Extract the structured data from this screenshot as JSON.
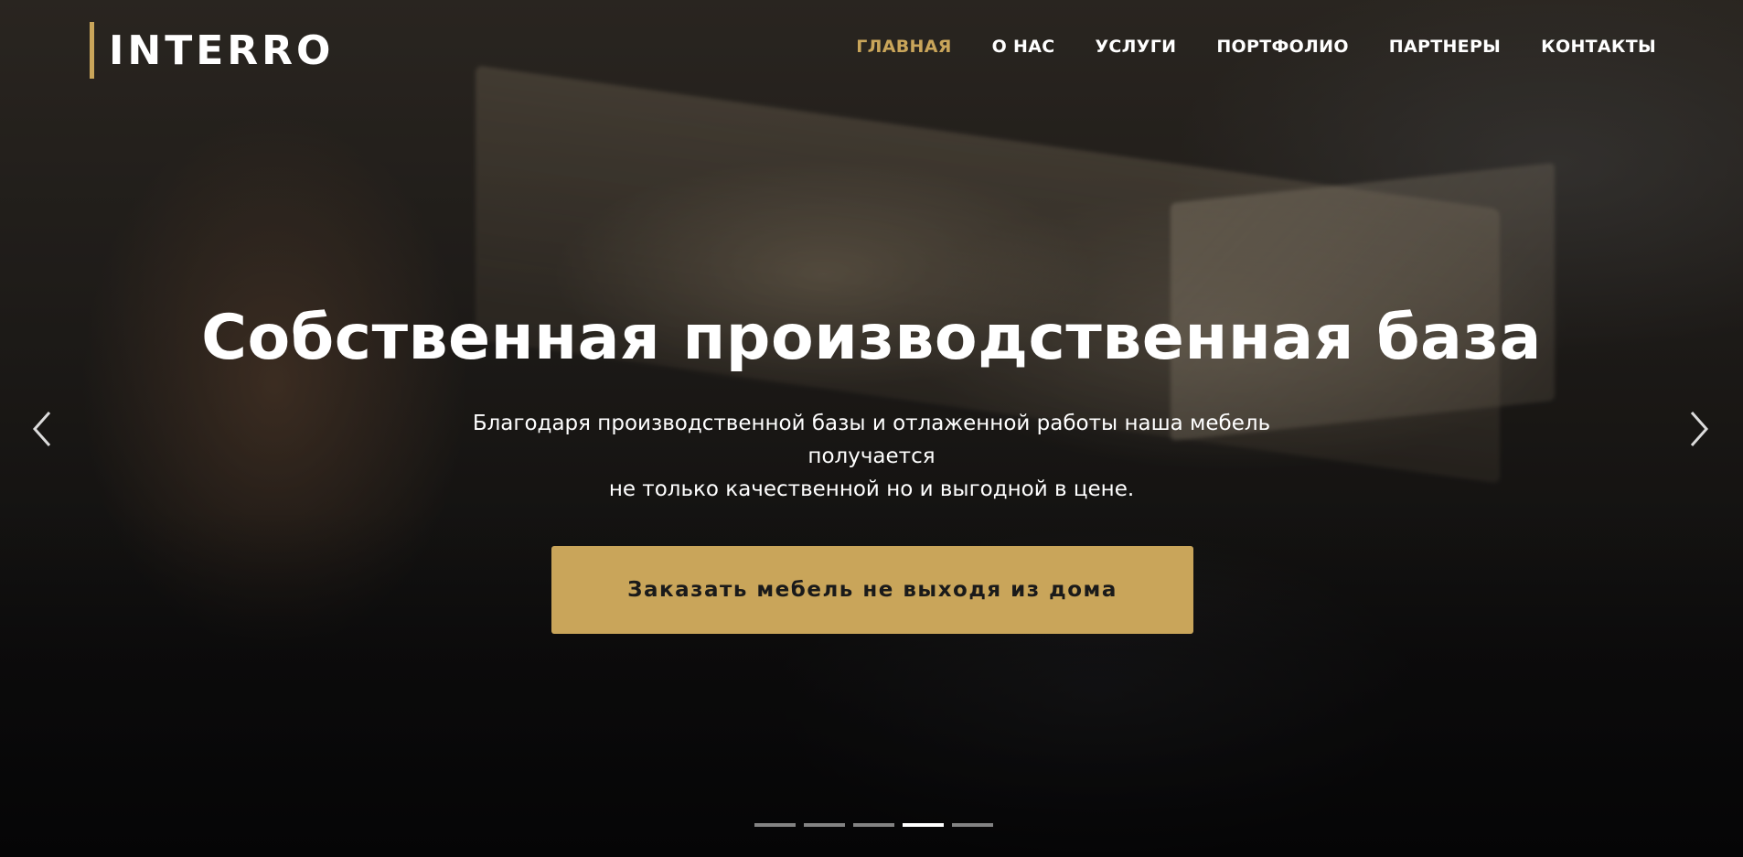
{
  "brand": {
    "name": "INTERRO",
    "accent_color": "#c9a55a"
  },
  "nav": {
    "items": [
      {
        "label": "ГЛАВНАЯ",
        "active": true
      },
      {
        "label": "О НАС",
        "active": false
      },
      {
        "label": "УСЛУГИ",
        "active": false
      },
      {
        "label": "ПОРТФОЛИО",
        "active": false
      },
      {
        "label": "ПАРТНЕРЫ",
        "active": false
      },
      {
        "label": "КОНТАКТЫ",
        "active": false
      }
    ]
  },
  "hero": {
    "headline": "Собственная производственная база",
    "subtitle_line1": "Благодаря производственной базы и отлаженной работы наша мебель получается",
    "subtitle_line2": "не только качественной но и выгодной в цене.",
    "cta_label": "Заказать мебель не выходя из дома"
  },
  "carousel": {
    "prev_icon": "chevron-left-icon",
    "next_icon": "chevron-right-icon",
    "slide_count": 5,
    "active_index": 3
  }
}
